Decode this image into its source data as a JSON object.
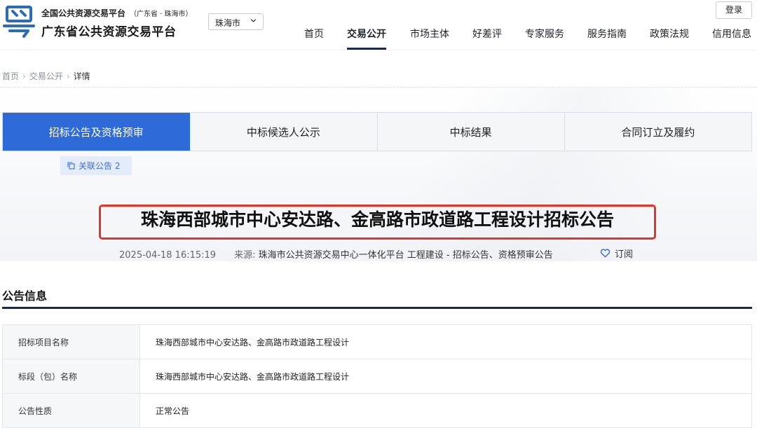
{
  "header": {
    "platform_top": "全国公共资源交易平台",
    "platform_region": "（广东省 · 珠海市）",
    "platform_name": "广东省公共资源交易平台",
    "city_select": "珠海市",
    "login_label": "登录",
    "nav": [
      {
        "label": "首页",
        "active": false
      },
      {
        "label": "交易公开",
        "active": true
      },
      {
        "label": "市场主体",
        "active": false
      },
      {
        "label": "好差评",
        "active": false
      },
      {
        "label": "专家服务",
        "active": false
      },
      {
        "label": "服务指南",
        "active": false
      },
      {
        "label": "政策法规",
        "active": false
      },
      {
        "label": "信用信息",
        "active": false
      }
    ]
  },
  "breadcrumb": [
    "首页",
    "交易公开",
    "详情"
  ],
  "breadcrumb_sep": "›",
  "tabs": [
    {
      "label": "招标公告及资格预审",
      "active": true
    },
    {
      "label": "中标候选人公示",
      "active": false
    },
    {
      "label": "中标结果",
      "active": false
    },
    {
      "label": "合同订立及履约",
      "active": false
    }
  ],
  "related_label": "关联公告 2",
  "notice": {
    "title": "珠海西部城市中心安达路、金高路市政道路工程设计招标公告",
    "datetime": "2025-04-18 16:15:19",
    "source_label": "来源:",
    "source": "珠海市公共资源交易中心一体化平台 工程建设 - 招标公告、资格预审公告",
    "subscribe_label": "订阅"
  },
  "info": {
    "section_title": "公告信息",
    "rows": [
      {
        "key": "招标项目名称",
        "value": "珠海西部城市中心安达路、金高路市政道路工程设计"
      },
      {
        "key": "标段（包）名称",
        "value": "珠海西部城市中心安达路、金高路市政道路工程设计"
      },
      {
        "key": "公告性质",
        "value": "正常公告"
      }
    ]
  },
  "colors": {
    "accent": "#2f6ad9",
    "highlight": "#e0352b",
    "nav_underline": "#1f2a44",
    "logo": "#2a6db5"
  },
  "icons": [
    "platform-logo-icon",
    "chevron-down-icon",
    "copy-icon",
    "heart-icon"
  ]
}
